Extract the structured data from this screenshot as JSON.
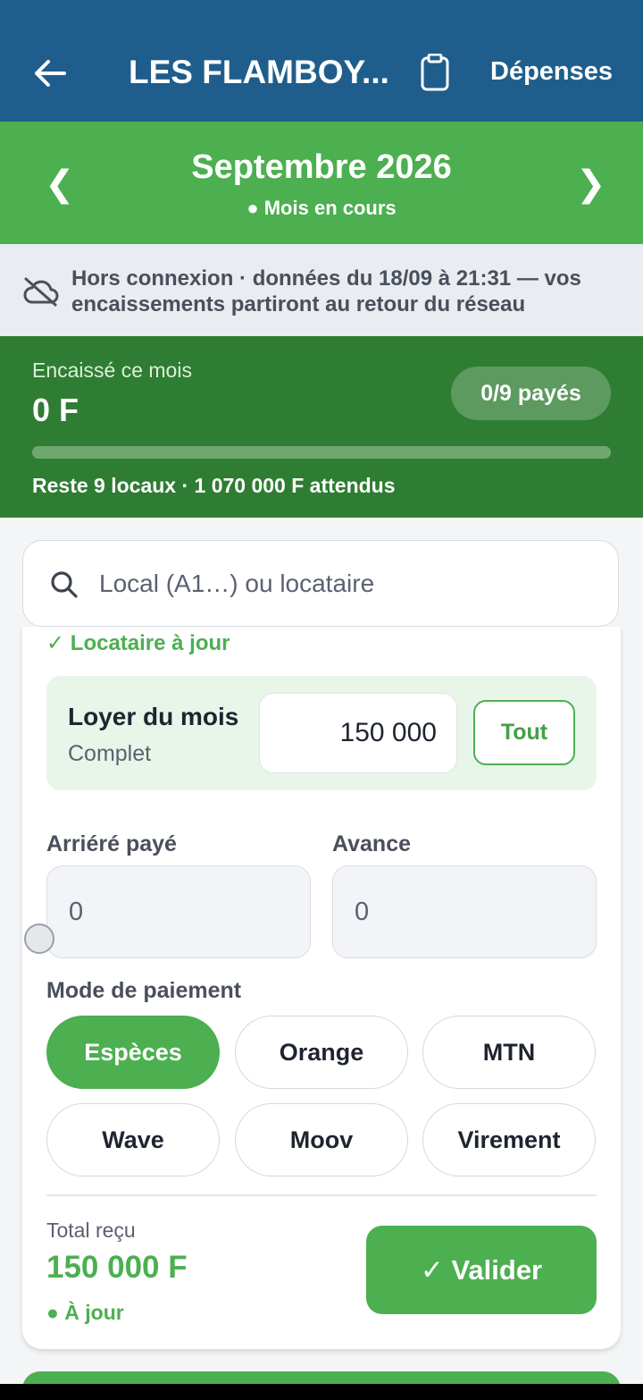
{
  "appbar": {
    "title": "LES FLAMBOY...",
    "expenses_label": "Dépenses"
  },
  "month": {
    "prev_glyph": "❮",
    "next_glyph": "❯",
    "title": "Septembre 2026",
    "status": "● Mois en cours"
  },
  "offline": {
    "message": "Hors connexion · données du 18/09 à 21:31 — vos encaissements partiront au retour du réseau"
  },
  "summary": {
    "label": "Encaissé ce mois",
    "amount": "0 F",
    "paid_badge": "0/9 payés",
    "progress_fraction": 0,
    "remaining": "Reste 9 locaux · 1 070 000 F attendus"
  },
  "search": {
    "placeholder": "Local (A1…) ou locataire"
  },
  "form": {
    "tenant_status": "✓ Locataire à jour",
    "rent_title": "Loyer du mois",
    "rent_subtitle": "Complet",
    "rent_value": "150 000",
    "all_button": "Tout",
    "arrears_label": "Arriéré payé",
    "arrears_value": "0",
    "advance_label": "Avance",
    "advance_value": "0",
    "payment_label": "Mode de paiement",
    "payment_methods": [
      "Espèces",
      "Orange",
      "MTN",
      "Wave",
      "Moov",
      "Virement"
    ],
    "selected_method": "Espèces",
    "total_label": "Total reçu",
    "total_amount": "150 000 F",
    "total_status": "● À jour",
    "validate_button": "✓ Valider"
  },
  "colors": {
    "appbar": "#1f5e8c",
    "primary_green": "#4caf50",
    "dark_green": "#2e7d32"
  }
}
